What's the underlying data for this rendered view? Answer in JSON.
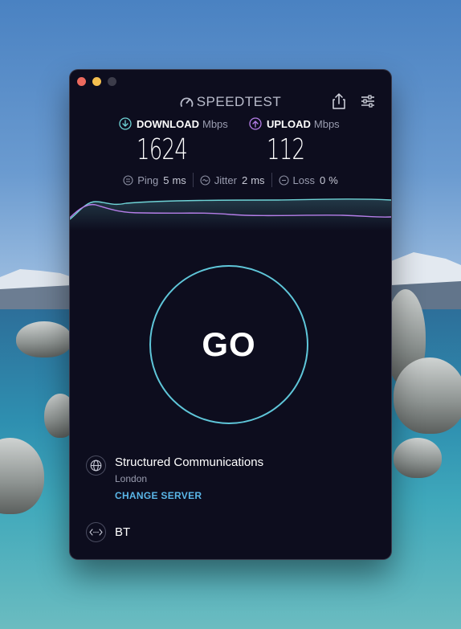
{
  "app": {
    "title": "SPEEDTEST"
  },
  "download": {
    "label": "DOWNLOAD",
    "unit": "Mbps",
    "value": "1624"
  },
  "upload": {
    "label": "UPLOAD",
    "unit": "Mbps",
    "value": "112"
  },
  "stats": {
    "ping": {
      "label": "Ping",
      "value": "5",
      "unit": "ms"
    },
    "jitter": {
      "label": "Jitter",
      "value": "2",
      "unit": "ms"
    },
    "loss": {
      "label": "Loss",
      "value": "0",
      "unit": "%"
    }
  },
  "go_label": "GO",
  "server": {
    "name": "Structured Communications",
    "city": "London",
    "change_label": "CHANGE SERVER"
  },
  "isp": {
    "name": "BT"
  },
  "colors": {
    "download": "#6fd3d6",
    "upload": "#b57ee8",
    "accent": "#5ab6e8",
    "go_ring": "#5fc6d9",
    "window_bg": "#0d0d1e"
  },
  "icons": {
    "brand": "gauge-icon",
    "share": "share-icon",
    "settings": "sliders-icon",
    "download": "arrow-down-circle-icon",
    "upload": "arrow-up-circle-icon",
    "server": "globe-icon",
    "isp": "connection-icon"
  }
}
